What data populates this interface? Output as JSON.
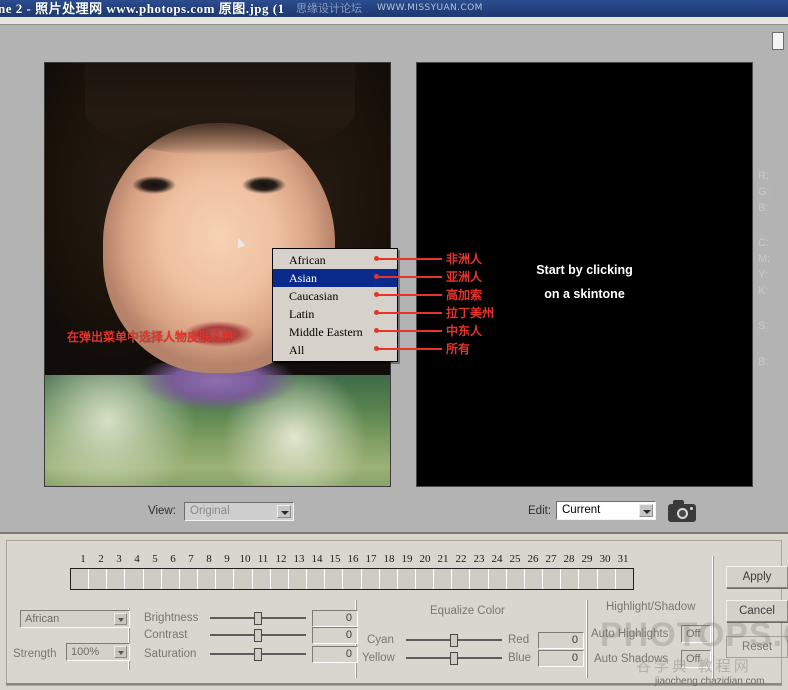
{
  "window": {
    "title": "ne 2 - 照片处理网 www.photops.com 原图.jpg (1",
    "watermark_forum": "思缘设计论坛",
    "watermark_site": "WWW.MISSYUAN.COM"
  },
  "photo": {
    "caption_cn": "在弹出菜单中选择人物皮肤人种",
    "cursor": "arrow-cursor"
  },
  "black_panel": {
    "line1": "Start by clicking",
    "line2": "on a skintone"
  },
  "menu": {
    "items": [
      {
        "label": "African",
        "selected": false,
        "cn": "非洲人"
      },
      {
        "label": "Asian",
        "selected": true,
        "cn": "亚洲人"
      },
      {
        "label": "Caucasian",
        "selected": false,
        "cn": "高加索"
      },
      {
        "label": "Latin",
        "selected": false,
        "cn": "拉丁美州"
      },
      {
        "label": "Middle Eastern",
        "selected": false,
        "cn": "中东人"
      },
      {
        "label": "All",
        "selected": false,
        "cn": "所有"
      }
    ]
  },
  "readouts": [
    {
      "label": "R:"
    },
    {
      "label": "G:"
    },
    {
      "label": "B:"
    },
    {
      "label": "C:"
    },
    {
      "label": "M:"
    },
    {
      "label": "Y:"
    },
    {
      "label": "K:"
    },
    {
      "label": "S:"
    },
    {
      "label": "B:"
    }
  ],
  "viewbar": {
    "view_label": "View:",
    "view_value": "Original",
    "edit_label": "Edit:",
    "edit_value": "Current",
    "camera_icon": "camera-icon"
  },
  "swatch_strip": {
    "numbers": [
      "1",
      "2",
      "3",
      "4",
      "5",
      "6",
      "7",
      "8",
      "9",
      "10",
      "11",
      "12",
      "13",
      "14",
      "15",
      "16",
      "17",
      "18",
      "19",
      "20",
      "21",
      "22",
      "23",
      "24",
      "25",
      "26",
      "27",
      "28",
      "29",
      "30",
      "31"
    ]
  },
  "controls": {
    "ethnicity_value": "African",
    "strength_label": "Strength",
    "strength_value": "100%",
    "brightness_label": "Brightness",
    "brightness_value": "0",
    "contrast_label": "Contrast",
    "contrast_value": "0",
    "saturation_label": "Saturation",
    "saturation_value": "0"
  },
  "equalize": {
    "title": "Equalize Color",
    "cyan_label": "Cyan",
    "red_label": "Red",
    "red_value": "0",
    "yellow_label": "Yellow",
    "blue_label": "Blue",
    "blue_value": "0"
  },
  "highlight_shadow": {
    "title": "Highlight/Shadow",
    "auto_highlights_label": "Auto Highlights",
    "auto_highlights_value": "Off",
    "auto_shadows_label": "Auto Shadows",
    "auto_shadows_value": "Off"
  },
  "buttons": {
    "apply": "Apply",
    "cancel": "Cancel",
    "reset": "Reset"
  },
  "watermarks": {
    "big": "PHOTOPS.COM",
    "cn": "谷学典 教程网",
    "bottom": "jiaocheng.chazidian.com"
  },
  "colors": {
    "titlebar": "#24427f",
    "menu_selected": "#0a2a8c",
    "annotation_red": "#e8332a",
    "panel_bg": "#d9d6cd",
    "app_bg": "#b3b3b3"
  }
}
